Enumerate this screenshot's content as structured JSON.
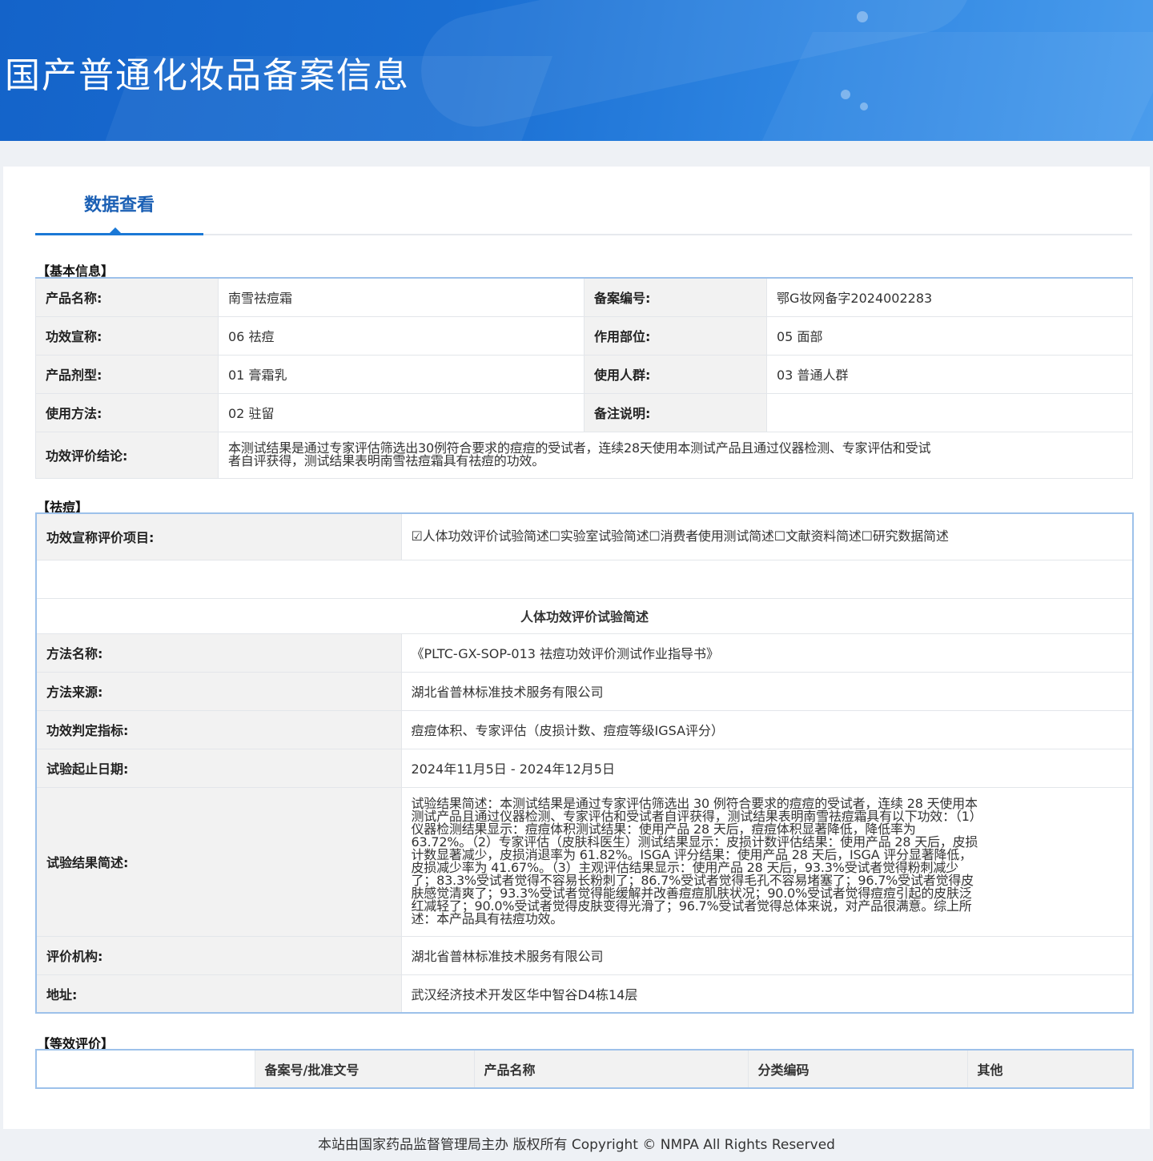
{
  "banner": {
    "title": "国产普通化妆品备案信息"
  },
  "tabs": [
    {
      "label": "数据查看"
    }
  ],
  "basic": {
    "section_title": "【基本信息】",
    "product_name_label": "产品名称:",
    "product_name": "南雪祛痘霜",
    "record_no_label": "备案编号:",
    "record_no": "鄂G妆网备字2024002283",
    "efficacy_label": "功效宣称:",
    "efficacy": "06 祛痘",
    "site_label": "作用部位:",
    "site": "05 面部",
    "dosage_label": "产品剂型:",
    "dosage": "01 膏霜乳",
    "users_label": "使用人群:",
    "users": "03 普通人群",
    "method_label": "使用方法:",
    "method": "02 驻留",
    "remark_label": "备注说明:",
    "remark": "",
    "conclusion_label": "功效评价结论:",
    "conclusion": "本测试结果是通过专家评估筛选出30例符合要求的痘痘的受试者，连续28天使用本测试产品且通过仪器检测、专家评估和受试者自评获得，测试结果表明南雪祛痘霜具有祛痘的功效。"
  },
  "acne": {
    "section_title": "【祛痘】",
    "items_label": "功效宣称评价项目:",
    "items": "☑人体功效评价试验简述☐实验室试验简述☐消费者使用测试简述☐文献资料简述☐研究数据简述",
    "subtitle": "人体功效评价试验简述",
    "method_name_label": "方法名称:",
    "method_name": "《PLTC-GX-SOP-013 祛痘功效评价测试作业指导书》",
    "method_source_label": "方法来源:",
    "method_source": "湖北省普林标准技术服务有限公司",
    "indicator_label": "功效判定指标:",
    "indicator": "痘痘体积、专家评估（皮损计数、痘痘等级IGSA评分）",
    "dates_label": "试验起止日期:",
    "dates": "2024年11月5日 - 2024年12月5日",
    "result_label": "试验结果简述:",
    "result": "试验结果简述：本测试结果是通过专家评估筛选出 30 例符合要求的痘痘的受试者，连续 28 天使用本测试产品且通过仪器检测、专家评估和受试者自评获得，测试结果表明南雪祛痘霜具有以下功效：（1）仪器检测结果显示：痘痘体积测试结果：使用产品 28 天后，痘痘体积显著降低，降低率为 63.72%。（2）专家评估（皮肤科医生）测试结果显示：皮损计数评估结果：使用产品 28 天后，皮损计数显著减少，皮损消退率为 61.82%。ISGA 评分结果：使用产品 28 天后，ISGA 评分显著降低，皮损减少率为 41.67%。（3）主观评估结果显示：使用产品 28 天后，93.3%受试者觉得粉刺减少了；83.3%受试者觉得不容易长粉刺了；86.7%受试者觉得毛孔不容易堵塞了；96.7%受试者觉得皮肤感觉清爽了；93.3%受试者觉得能缓解并改善痘痘肌肤状况；90.0%受试者觉得痘痘引起的皮肤泛红减轻了；90.0%受试者觉得皮肤变得光滑了；96.7%受试者觉得总体来说，对产品很满意。综上所述：本产品具有祛痘功效。",
    "org_label": "评价机构:",
    "org": "湖北省普林标准技术服务有限公司",
    "address_label": "地址:",
    "address": "武汉经济技术开发区华中智谷D4栋14层"
  },
  "equiv": {
    "section_title": "【等效评价】",
    "headers": [
      "备案号/批准文号",
      "产品名称",
      "分类编码",
      "其他"
    ]
  },
  "footer": {
    "text": "本站由国家药品监督管理局主办 版权所有 Copyright © NMPA All Rights Reserved"
  }
}
